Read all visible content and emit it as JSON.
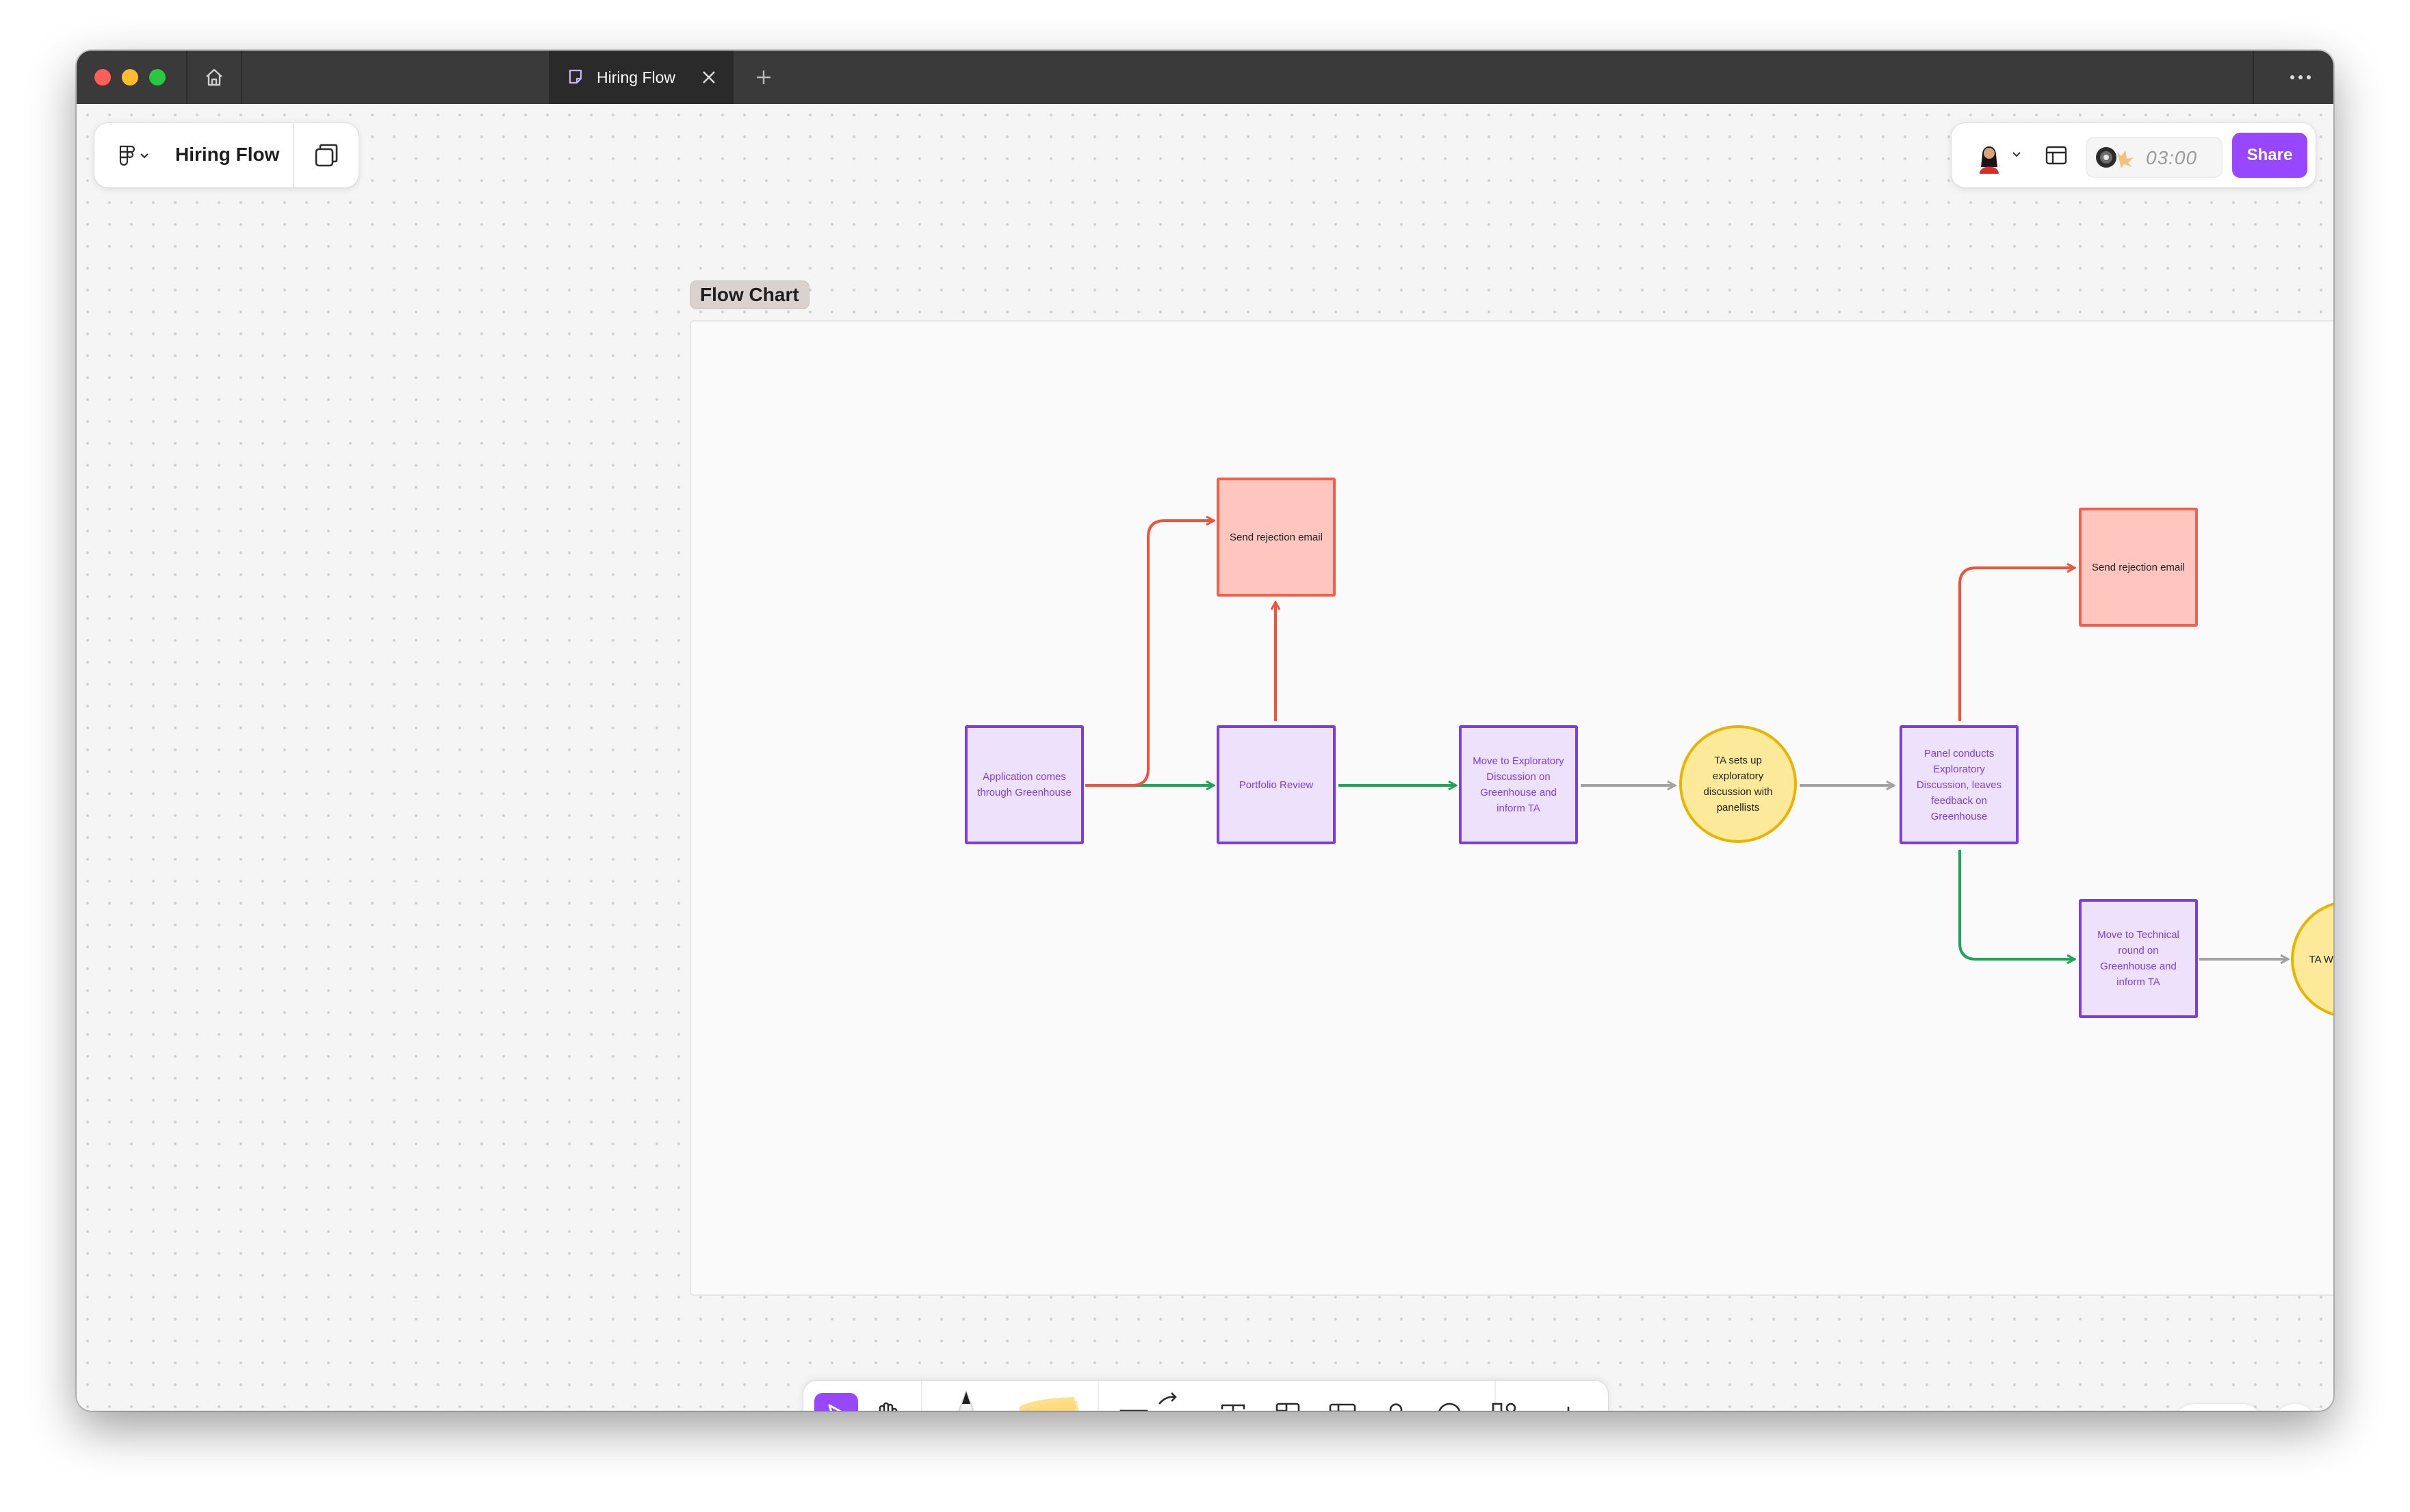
{
  "window": {
    "tab_title": "Hiring Flow"
  },
  "file": {
    "title": "Hiring Flow"
  },
  "header": {
    "timer": "03:00",
    "share_label": "Share"
  },
  "section": {
    "label": "Flow Chart"
  },
  "flow": {
    "nodes": {
      "application": "Application comes through Greenhouse",
      "reject_1": "Send rejection email",
      "portfolio": "Portfolio Review",
      "exploratory_move": "Move to Exploratory Discussion on Greenhouse and inform TA",
      "ta_setup": "TA sets up exploratory discussion with panellists",
      "panel": "Panel conducts Exploratory Discussion, leaves feedback on Greenhouse",
      "reject_2": "Send rejection email",
      "technical_move": "Move to Technical round on Greenhouse and inform TA",
      "ta_partial": "TA Whit roun right"
    }
  },
  "colors": {
    "accent": "#9747ff",
    "process_border": "#7b3fe0",
    "process_fill": "#ede1fc",
    "reject_border": "#f0624d",
    "reject_fill": "#ffc6c0",
    "decision_border": "#e8b400",
    "decision_fill": "#fde99a",
    "arrow_green": "#1ea558",
    "arrow_red": "#f0523a",
    "arrow_gray": "#a3a3a3"
  },
  "icons": {
    "home": "home-icon",
    "tab": "figjam-file-icon",
    "close": "close-icon",
    "new_tab": "plus-icon",
    "more": "ellipsis-icon",
    "main_menu": "figma-logo-icon",
    "pages": "pages-icon",
    "layout": "layout-icon",
    "timer": "timer-icon",
    "help": "?"
  }
}
